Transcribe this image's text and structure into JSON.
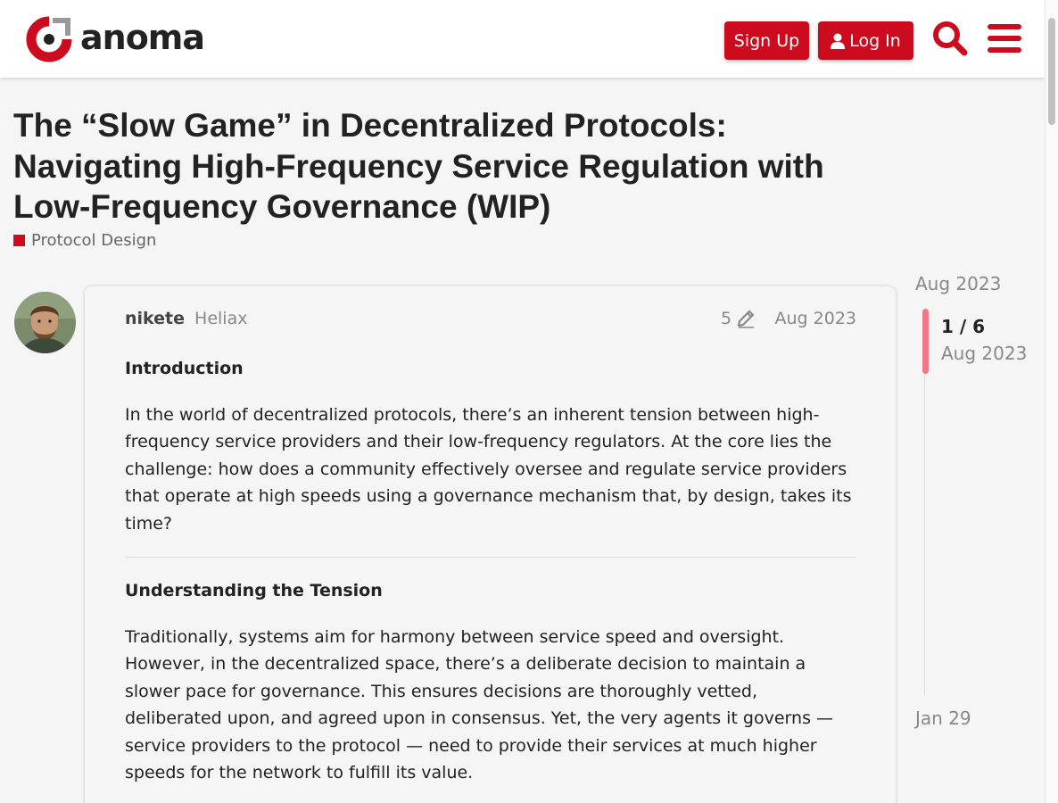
{
  "brand": {
    "name": "anoma",
    "accent": "#cc0b1f"
  },
  "header": {
    "signup_label": "Sign Up",
    "login_label": "Log In",
    "search_icon": "search-icon",
    "menu_icon": "hamburger-menu-icon"
  },
  "topic": {
    "title": "The “Slow Game” in Decentralized Protocols: Navigating High-Frequency Service Regulation with Low-Frequency Governance (WIP)",
    "category": "Protocol Design",
    "category_color": "#cc0b1f"
  },
  "post": {
    "username": "nikete",
    "user_title": "Heliax",
    "edit_count": "5",
    "date": "Aug 2023",
    "sections": [
      {
        "heading": "Introduction",
        "paragraph": "In the world of decentralized protocols, there’s an inherent tension between high-frequency service providers and their low-frequency regulators. At the core lies the challenge: how does a community effectively oversee and regulate service providers that operate at high speeds using a governance mechanism that, by design, takes its time?"
      },
      {
        "heading": "Understanding the Tension",
        "paragraph": "Traditionally, systems aim for harmony between service speed and oversight. However, in the decentralized space, there’s a deliberate decision to maintain a slower pace for governance. This ensures decisions are thoroughly vetted, deliberated upon, and agreed upon in consensus. Yet, the very agents it governs — service providers to the protocol — need to provide their services at much higher speeds for the network to fulfill its value."
      }
    ]
  },
  "timeline": {
    "start_date": "Aug 2023",
    "position": "1 / 6",
    "current_date": "Aug 2023",
    "end_date": "Jan 29"
  }
}
